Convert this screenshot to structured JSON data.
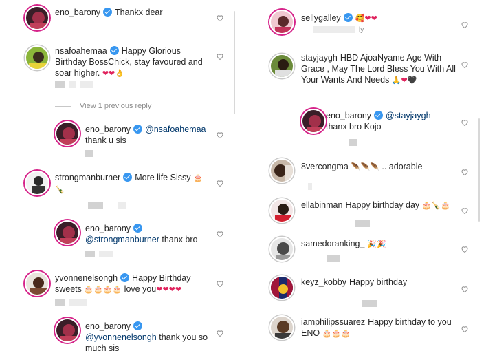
{
  "left_panel": {
    "comments": [
      {
        "user": "eno_barony",
        "verified": true,
        "text": "Thankx dear"
      },
      {
        "user": "nsafoahemaa",
        "verified": true,
        "text_line1": "Happy Glorious",
        "text_line2": "Birthday BossChick, stay favoured and",
        "text_line3": "soar higher.",
        "emoji": "❤❤👌"
      },
      {
        "view_replies": "View 1 previous reply"
      },
      {
        "user": "eno_barony",
        "verified": true,
        "mention": "@nsafoahemaa",
        "text": "thank u sis"
      },
      {
        "user": "strongmanburner",
        "verified": true,
        "text": "More life Sissy",
        "emoji": "🎂",
        "emoji2": "🍾"
      },
      {
        "user": "eno_barony",
        "verified": true,
        "mention": "@strongmanburner",
        "text": "thanx bro"
      },
      {
        "user": "yvonnenelsongh",
        "verified": true,
        "text_line1": "Happy Birthday",
        "text_line2": "sweets",
        "emoji_cakes": "🎂🎂🎂🎂",
        "text_after": "love you",
        "emoji_hearts": "❤❤❤❤"
      },
      {
        "user": "eno_barony",
        "verified": true,
        "mention": "@yvonnenelsongh",
        "text_line1": "thank you so",
        "text_line2": "much sis"
      }
    ]
  },
  "right_panel": {
    "comments": [
      {
        "user": "sellygalley",
        "verified": true,
        "emoji": "🥰❤❤",
        "meta_fragment": "ly"
      },
      {
        "user": "stayjaygh",
        "verified": false,
        "text_line1": "HBD AjoaNyame Age With",
        "text_line2": "Grace , May The Lord Bless You With All",
        "text_line3": "Your Wants And Needs",
        "emoji": "🙏❤🖤"
      },
      {
        "user": "eno_barony",
        "verified": true,
        "mention": "@stayjaygh",
        "text": "thanx bro Kojo"
      },
      {
        "user": "8vercongma",
        "verified": false,
        "emoji": "🪶🪶🪶",
        "text": ".. adorable"
      },
      {
        "user": "ellabinman",
        "verified": false,
        "text": "Happy birthday day",
        "emoji": "🎂🍾🎂"
      },
      {
        "user": "samedoranking_",
        "verified": false,
        "emoji": "🎉🎉"
      },
      {
        "user": "keyz_kobby",
        "verified": false,
        "text": "Happy birthday"
      },
      {
        "user": "iamphilipssuarez",
        "verified": false,
        "text_line1": "Happy birthday to you",
        "text_line2": "ENO",
        "emoji": "🎂🎂🎂"
      }
    ]
  },
  "colors": {
    "verified": "#3897f0",
    "text": "#262626",
    "mention": "#00376b",
    "muted": "#8e8e8e",
    "story_ring": "#d6248a"
  }
}
